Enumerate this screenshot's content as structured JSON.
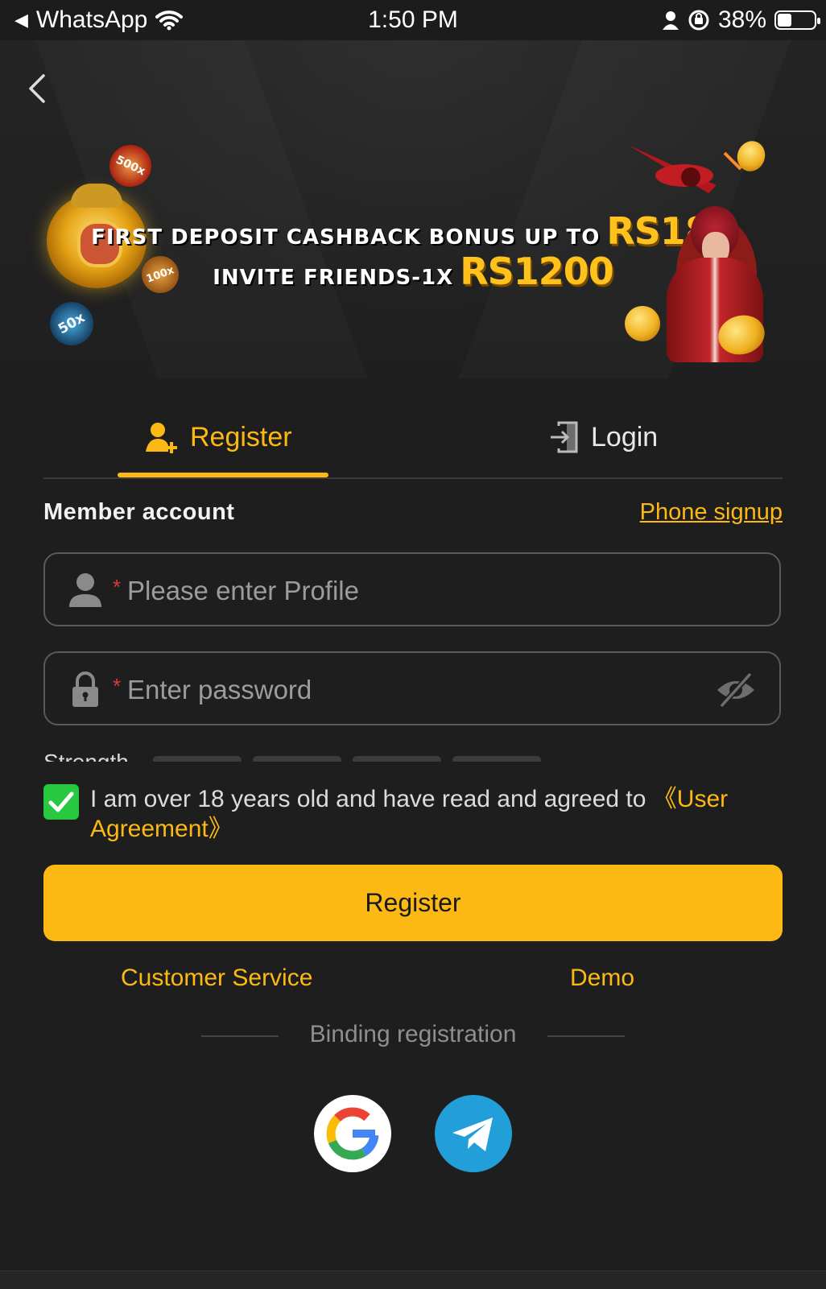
{
  "status_bar": {
    "back_app": "WhatsApp",
    "time": "1:50 PM",
    "battery": "38%",
    "battery_level": 0.38
  },
  "banner": {
    "line1_text": "FIRST DEPOSIT CASHBACK BONUS UP TO",
    "line1_amount": "RS188",
    "line2_text": "INVITE FRIENDS-1X",
    "line2_amount": "RS1200",
    "chips": [
      "500x",
      "100x",
      "50x"
    ]
  },
  "tabs": {
    "register": "Register",
    "login": "Login"
  },
  "form": {
    "section_title": "Member account",
    "phone_signup": "Phone signup",
    "profile_placeholder": "Please enter Profile",
    "password_placeholder": "Enter password",
    "required_mark": "*",
    "strength_label": "Strength"
  },
  "agreement": {
    "checked": true,
    "text": "I am over 18 years old and have read and agreed to ",
    "link": "《User Agreement》"
  },
  "actions": {
    "register_button": "Register",
    "customer_service": "Customer Service",
    "demo": "Demo"
  },
  "binding": {
    "label": "Binding registration"
  },
  "colors": {
    "accent": "#fdb913",
    "background": "#1e1e1e",
    "checkbox": "#28c840",
    "telegram": "#229ed9"
  },
  "icons": [
    "back-chevron-icon",
    "wifi-icon",
    "person-icon",
    "orientation-lock-icon",
    "add-user-icon",
    "login-door-icon",
    "user-icon",
    "lock-icon",
    "eye-off-icon",
    "check-icon",
    "google-icon",
    "telegram-icon"
  ]
}
